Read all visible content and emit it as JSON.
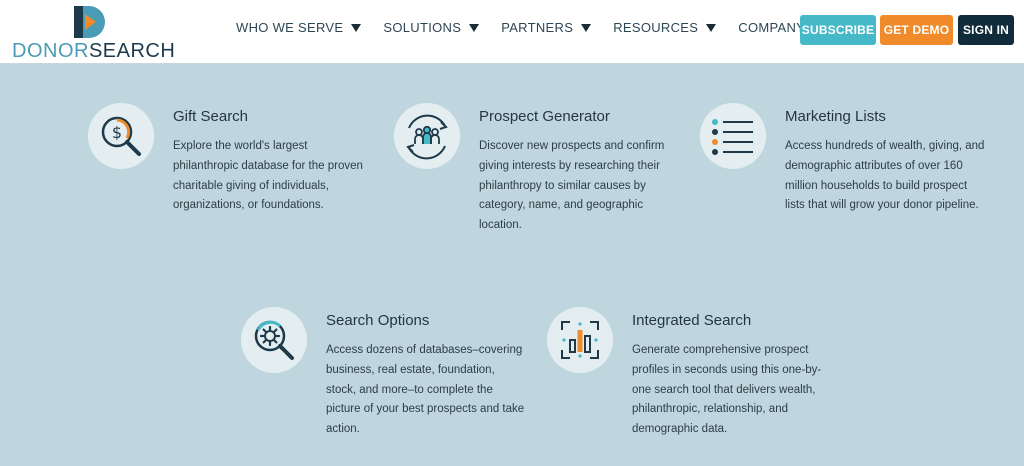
{
  "header": {
    "logo": {
      "part1": "DONOR",
      "part2": "SEARCH"
    },
    "nav": [
      {
        "label": "WHO WE SERVE"
      },
      {
        "label": "SOLUTIONS"
      },
      {
        "label": "PARTNERS"
      },
      {
        "label": "RESOURCES"
      },
      {
        "label": "COMPANY"
      }
    ],
    "buttons": {
      "subscribe": "SUBSCRIBE",
      "get_demo": "GET DEMO",
      "sign_in": "SIGN IN"
    }
  },
  "features": [
    {
      "icon": "dollar-magnifier-icon",
      "title": "Gift Search",
      "description": "Explore the world's largest philanthropic database for the proven charitable giving of individuals, organizations, or foundations."
    },
    {
      "icon": "people-cycle-icon",
      "title": "Prospect Generator",
      "description": "Discover new prospects and confirm giving interests by researching their philanthropy to similar causes by category, name, and geographic location."
    },
    {
      "icon": "list-icon",
      "title": "Marketing Lists",
      "description": "Access hundreds of wealth, giving, and demographic attributes of over 160 million households to build prospect lists that will grow your donor pipeline."
    },
    {
      "icon": "gear-magnifier-icon",
      "title": "Search Options",
      "description": "Access dozens of databases–covering business, real estate, foundation, stock, and more–to complete the picture of your best prospects and take action."
    },
    {
      "icon": "bar-chart-scan-icon",
      "title": "Integrated Search",
      "description": "Generate comprehensive prospect profiles in seconds using this one-by-one search tool that delivers wealth, philanthropic, relationship, and demographic data."
    }
  ],
  "colors": {
    "background": "#bfd6de",
    "subscribe": "#46b9c9",
    "get_demo": "#f08a2a",
    "sign_in": "#102b3a",
    "accent_orange": "#f08a2a",
    "accent_teal": "#46b9c9"
  }
}
